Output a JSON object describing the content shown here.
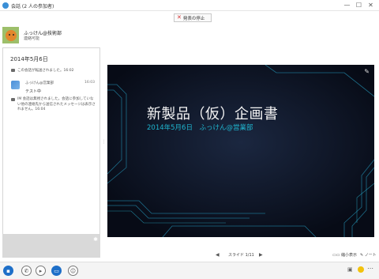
{
  "window": {
    "title": "会話 (2 人の参加者)",
    "buttons": {
      "minimize": "—",
      "maximize": "☐",
      "close": "✕"
    }
  },
  "toolbar": {
    "stop_presenting_label": "発表の停止"
  },
  "contact": {
    "name": "ふっけん@技術部",
    "status": "連絡可能"
  },
  "chat": {
    "date": "2014年5月6日",
    "system_message": "この会話が転送されました。16:02",
    "message": {
      "sender": "ふっけん@営業部",
      "time": "16:03",
      "text": "テスト中",
      "note": "IM 会話は無視されました。会話に参加していない他の連絡先から送信されたメッセージは表示されません。16:04"
    }
  },
  "slide": {
    "title": "新製品（仮）企画書",
    "subtitle": "2014年5月6日　ふっけん@営業部",
    "colors": {
      "background": "#0a0f1e",
      "accent": "#1fb6d0"
    }
  },
  "slide_nav": {
    "label": "スライド 1/11",
    "thumbnails_label": "縮小表示",
    "notes_label": "ノート"
  },
  "icons": {
    "app": "lync-icon",
    "chat": "chat-bubble-icon",
    "call": "phone-icon",
    "video": "camera-icon",
    "present": "monitor-icon",
    "people": "people-icon"
  }
}
